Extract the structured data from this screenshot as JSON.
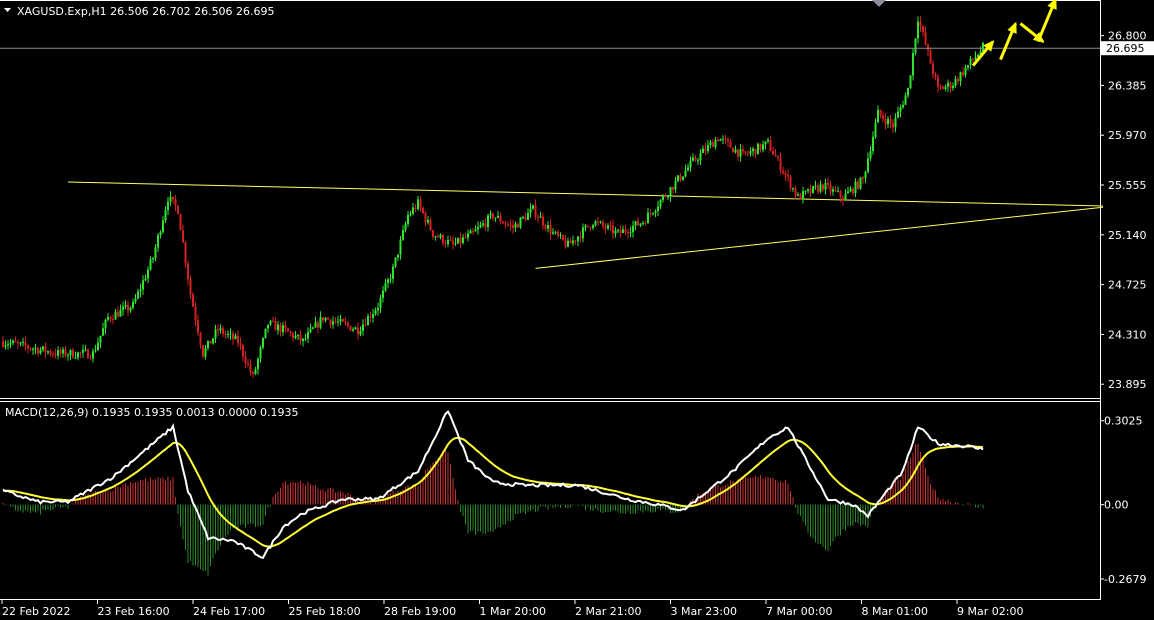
{
  "window": {
    "symbol_header": "XAGUSD.Exp,H1  26.506 26.702 26.506 26.695",
    "header_arrow_icon": "triangle-down-icon"
  },
  "price_axis": {
    "labels": [
      "26.800",
      "26.385",
      "25.970",
      "25.555",
      "25.140",
      "24.725",
      "24.310",
      "23.895"
    ],
    "current_price": "26.695"
  },
  "macd": {
    "header": "MACD(12,26,9) 0.1935 0.1935 0.0013 0.0000 0.1935",
    "axis_labels": [
      "0.3025",
      "0.00",
      "-0.2679"
    ]
  },
  "time_axis": {
    "labels": [
      "22 Feb 2022",
      "23 Feb 16:00",
      "24 Feb 17:00",
      "25 Feb 18:00",
      "28 Feb 19:00",
      "1 Mar 20:00",
      "2 Mar 21:00",
      "3 Mar 23:00",
      "7 Mar 00:00",
      "8 Mar 01:00",
      "9 Mar 02:00"
    ]
  },
  "colors": {
    "background": "#000000",
    "bull": "#2ee62e",
    "bear": "#d42020",
    "trendline": "#ffff66",
    "arrow": "#ffff00",
    "macd_line": "#ffffff",
    "signal_line": "#ffff33",
    "hist_pos": "#c83030",
    "hist_neg": "#2a8a2a",
    "axis": "#ffffff",
    "price_line": "#8c8c9a"
  },
  "chart_data": {
    "type": "candlestick",
    "price": {
      "ylim": [
        23.78,
        27.08
      ],
      "current": 26.695,
      "anchors": [
        [
          0,
          24.25
        ],
        [
          22,
          24.15
        ],
        [
          36,
          24.15
        ],
        [
          42,
          24.45
        ],
        [
          52,
          24.55
        ],
        [
          60,
          24.95
        ],
        [
          66,
          25.45
        ],
        [
          70,
          25.35
        ],
        [
          75,
          24.65
        ],
        [
          80,
          24.15
        ],
        [
          86,
          24.35
        ],
        [
          94,
          24.25
        ],
        [
          100,
          23.95
        ],
        [
          106,
          24.4
        ],
        [
          112,
          24.35
        ],
        [
          120,
          24.25
        ],
        [
          128,
          24.45
        ],
        [
          135,
          24.4
        ],
        [
          142,
          24.35
        ],
        [
          150,
          24.55
        ],
        [
          156,
          24.85
        ],
        [
          162,
          25.3
        ],
        [
          166,
          25.4
        ],
        [
          172,
          25.15
        ],
        [
          180,
          25.05
        ],
        [
          188,
          25.15
        ],
        [
          196,
          25.3
        ],
        [
          204,
          25.2
        ],
        [
          212,
          25.35
        ],
        [
          220,
          25.15
        ],
        [
          226,
          25.05
        ],
        [
          236,
          25.25
        ],
        [
          246,
          25.15
        ],
        [
          256,
          25.25
        ],
        [
          268,
          25.55
        ],
        [
          276,
          25.75
        ],
        [
          286,
          25.95
        ],
        [
          296,
          25.8
        ],
        [
          306,
          25.9
        ],
        [
          318,
          25.45
        ],
        [
          328,
          25.55
        ],
        [
          336,
          25.45
        ],
        [
          344,
          25.6
        ],
        [
          350,
          26.15
        ],
        [
          356,
          26.05
        ],
        [
          362,
          26.35
        ],
        [
          366,
          26.95
        ],
        [
          370,
          26.65
        ],
        [
          374,
          26.35
        ],
        [
          380,
          26.4
        ],
        [
          386,
          26.55
        ],
        [
          392,
          26.7
        ]
      ]
    },
    "trendlines": [
      {
        "name": "upper",
        "x1": 26,
        "y1": 25.58,
        "x2": 440,
        "y2": 25.38
      },
      {
        "name": "lower",
        "x1": 213,
        "y1": 24.86,
        "x2": 440,
        "y2": 25.37
      }
    ],
    "projection_arrows": [
      [
        [
          388,
          26.55
        ],
        [
          396,
          26.75
        ]
      ],
      [
        [
          399,
          26.6
        ],
        [
          405,
          26.9
        ]
      ],
      [
        [
          407,
          26.9
        ],
        [
          416,
          26.75
        ]
      ],
      [
        [
          414,
          26.75
        ],
        [
          421,
          27.1
        ]
      ]
    ],
    "macd": {
      "ylim": [
        -0.34,
        0.37
      ],
      "zero": 0.0,
      "anchors": [
        [
          0,
          0.05
        ],
        [
          14,
          0.01
        ],
        [
          26,
          0.01
        ],
        [
          44,
          0.1
        ],
        [
          60,
          0.22
        ],
        [
          68,
          0.28
        ],
        [
          74,
          0.05
        ],
        [
          82,
          -0.12
        ],
        [
          92,
          -0.13
        ],
        [
          104,
          -0.19
        ],
        [
          112,
          -0.08
        ],
        [
          120,
          -0.03
        ],
        [
          136,
          0.02
        ],
        [
          150,
          0.02
        ],
        [
          166,
          0.12
        ],
        [
          178,
          0.34
        ],
        [
          186,
          0.16
        ],
        [
          196,
          0.08
        ],
        [
          208,
          0.07
        ],
        [
          230,
          0.07
        ],
        [
          250,
          0.02
        ],
        [
          262,
          0.0
        ],
        [
          272,
          -0.02
        ],
        [
          292,
          0.12
        ],
        [
          306,
          0.24
        ],
        [
          314,
          0.28
        ],
        [
          320,
          0.18
        ],
        [
          330,
          0.02
        ],
        [
          340,
          0.0
        ],
        [
          346,
          -0.04
        ],
        [
          352,
          0.03
        ],
        [
          360,
          0.12
        ],
        [
          366,
          0.28
        ],
        [
          374,
          0.22
        ],
        [
          386,
          0.21
        ],
        [
          392,
          0.2
        ]
      ]
    }
  }
}
